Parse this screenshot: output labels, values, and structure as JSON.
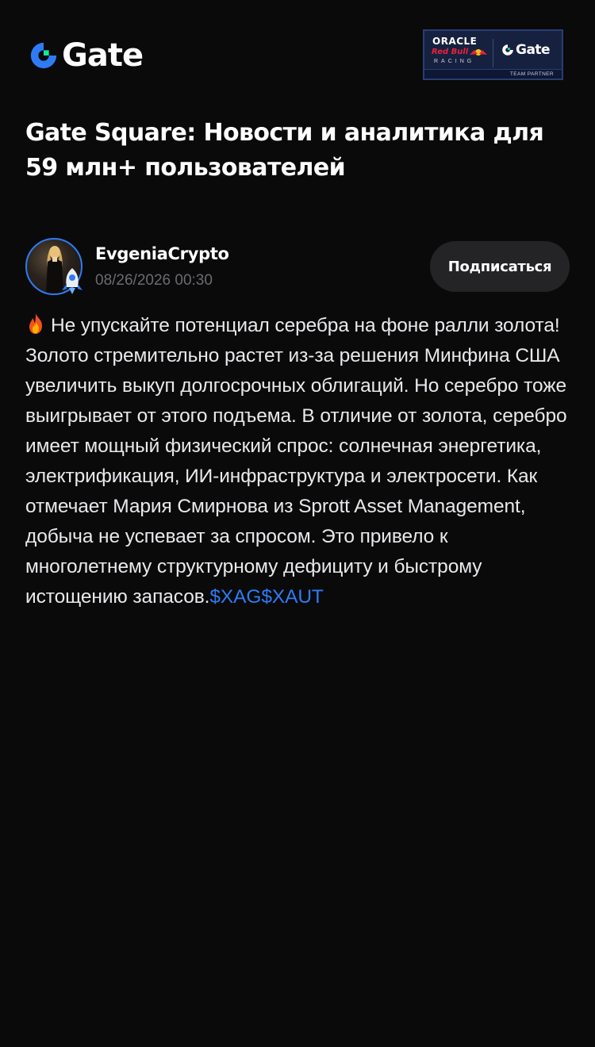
{
  "header": {
    "logo_text": "Gate",
    "partner": {
      "oracle": "ORACLE",
      "redbull": "Red Bull",
      "racing": "RACING",
      "gate": "Gate",
      "team_partner": "TEAM PARTNER"
    }
  },
  "page": {
    "title": "Gate Square: Новости и аналитика для 59 млн+ пользователей"
  },
  "post": {
    "author": "EvgeniaCrypto",
    "timestamp": "08/26/2026 00:30",
    "follow_label": "Подписаться",
    "body": "Не упускайте потенциал серебра на фоне ралли золота! Золото стремительно растет из-за решения Минфина США увеличить выкуп долгосрочных облигаций. Но серебро тоже выигрывает от этого подъема. В отличие от золота, серебро имеет мощный физический спрос: солнечная энергетика, электрификация, ИИ-инфраструктура и электросети. Как отмечает Мария Смирнова из Sprott Asset Management, добыча не успевает за спросом. Это привело к многолетнему структурному дефициту и быстрому истощению запасов.",
    "tickers": [
      "$XAG",
      "$XAUT"
    ],
    "icons": {
      "emoji": "fire-icon",
      "avatar_badge": "rocket-badge-icon"
    }
  },
  "colors": {
    "background": "#0a0a0b",
    "accent": "#2f7bf5",
    "logo_green": "#17e5a1",
    "button_bg": "#242427",
    "muted_text": "#6b6b70"
  }
}
